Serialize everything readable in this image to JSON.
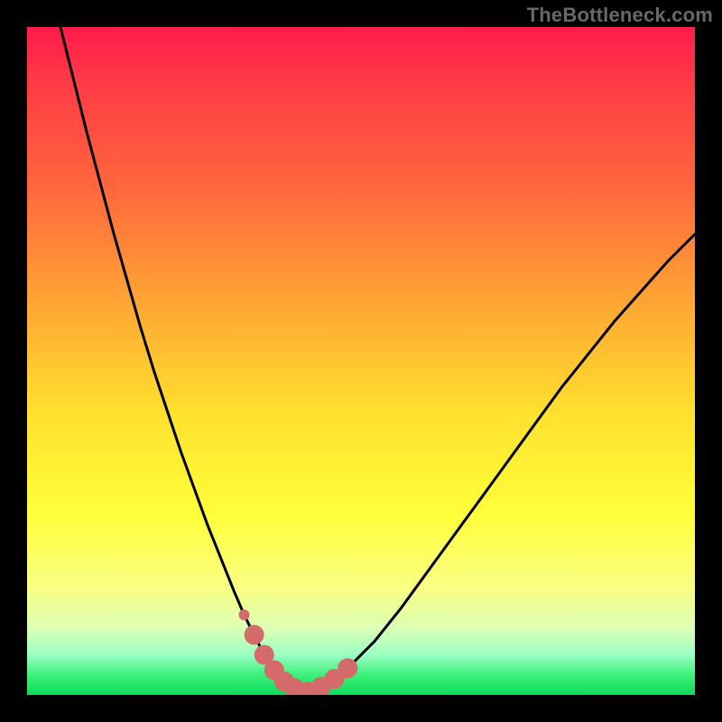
{
  "watermark": "TheBottleneck.com",
  "colors": {
    "frame_bg": "#000000",
    "curve_stroke": "#000000",
    "marker_fill": "#d46a6a",
    "gradient_stops": [
      "#ff1b4a",
      "#ff3946",
      "#ff6a3c",
      "#ffa833",
      "#ffe12e",
      "#ffff3a",
      "#f9ff84",
      "#dcffb4",
      "#9bffc4",
      "#3df079",
      "#0ddb5e"
    ]
  },
  "chart_data": {
    "type": "line",
    "title": "",
    "xlabel": "",
    "ylabel": "",
    "xlim": [
      0,
      100
    ],
    "ylim": [
      0,
      100
    ],
    "grid": false,
    "legend": "none",
    "series": [
      {
        "name": "bottleneck-curve",
        "x": [
          5,
          7,
          9,
          11,
          13,
          15,
          17,
          19,
          21,
          23,
          25,
          27,
          29,
          31,
          32.5,
          34,
          35.5,
          37,
          38.5,
          40,
          42,
          45,
          48,
          52,
          56,
          60,
          64,
          68,
          72,
          76,
          80,
          84,
          88,
          92,
          96,
          100
        ],
        "y": [
          100,
          92,
          84,
          76.5,
          69,
          62,
          55,
          48.5,
          42.5,
          36.5,
          31,
          25.5,
          20.5,
          15.5,
          12,
          9,
          6,
          3.7,
          2,
          1,
          0.5,
          1.5,
          4,
          8,
          13,
          18.5,
          24,
          29.5,
          35,
          40.5,
          46,
          51,
          56,
          60.5,
          65,
          69
        ]
      }
    ],
    "markers": {
      "name": "highlight-points",
      "color": "#d46a6a",
      "points": [
        {
          "x": 32.5,
          "y": 12,
          "r": 6
        },
        {
          "x": 34,
          "y": 9,
          "r": 11
        },
        {
          "x": 35.5,
          "y": 6,
          "r": 11
        },
        {
          "x": 37,
          "y": 3.7,
          "r": 11
        },
        {
          "x": 38.5,
          "y": 2,
          "r": 11
        },
        {
          "x": 40,
          "y": 1,
          "r": 11
        },
        {
          "x": 42,
          "y": 0.5,
          "r": 11
        },
        {
          "x": 44,
          "y": 1.2,
          "r": 11
        },
        {
          "x": 46,
          "y": 2.4,
          "r": 11
        },
        {
          "x": 48,
          "y": 4,
          "r": 11
        }
      ]
    }
  }
}
